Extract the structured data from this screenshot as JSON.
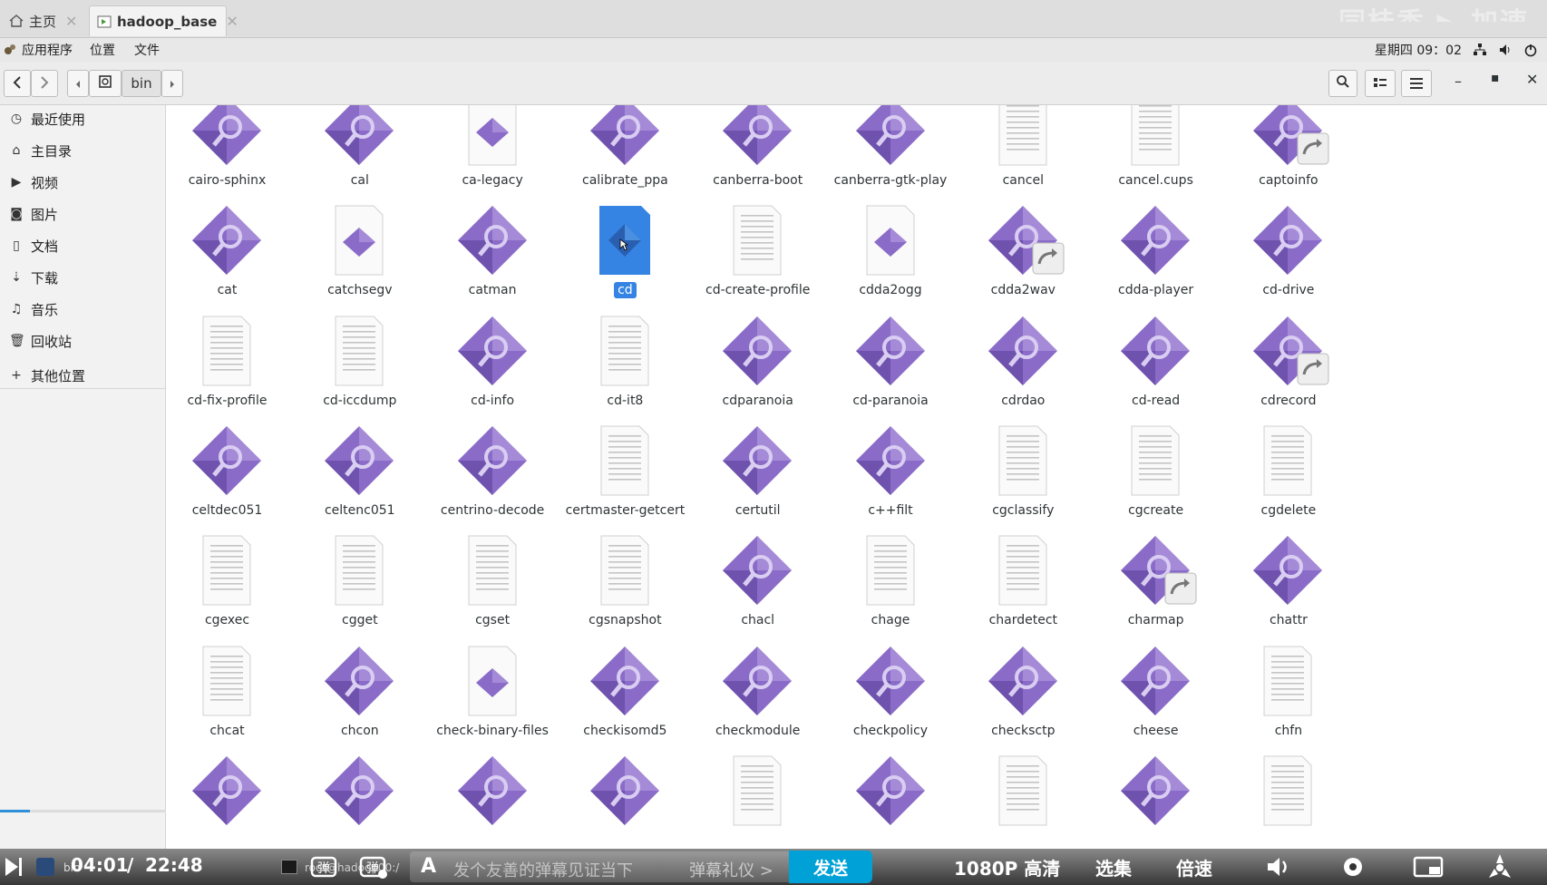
{
  "tabs": [
    {
      "label": "主页"
    },
    {
      "label": "hadoop_base"
    }
  ],
  "watermark": "同桂香 ▶ 加速",
  "menubar": {
    "items": [
      "应用程序",
      "位置",
      "文件"
    ],
    "clock": "星期四 09：02"
  },
  "toolbar": {
    "path_segment": "bin"
  },
  "sidebar": {
    "items": [
      {
        "label": "最近使用",
        "icon": "clock-icon"
      },
      {
        "label": "主目录",
        "icon": "home-icon"
      },
      {
        "label": "视频",
        "icon": "video-icon"
      },
      {
        "label": "图片",
        "icon": "camera-icon"
      },
      {
        "label": "文档",
        "icon": "document-icon"
      },
      {
        "label": "下载",
        "icon": "download-icon"
      },
      {
        "label": "音乐",
        "icon": "music-icon"
      },
      {
        "label": "回收站",
        "icon": "trash-icon"
      }
    ],
    "other": {
      "label": "其他位置",
      "icon": "plus-icon"
    },
    "playback_progress": 0.178
  },
  "files": [
    [
      {
        "name": "cairo-sphinx",
        "type": "exec"
      },
      {
        "name": "cal",
        "type": "exec"
      },
      {
        "name": "ca-legacy",
        "type": "script"
      },
      {
        "name": "calibrate_ppa",
        "type": "exec"
      },
      {
        "name": "canberra-boot",
        "type": "exec"
      },
      {
        "name": "canberra-gtk-play",
        "type": "exec"
      },
      {
        "name": "cancel",
        "type": "text"
      },
      {
        "name": "cancel.cups",
        "type": "text"
      },
      {
        "name": "captoinfo",
        "type": "link"
      }
    ],
    [
      {
        "name": "cat",
        "type": "exec"
      },
      {
        "name": "catchsegv",
        "type": "script"
      },
      {
        "name": "catman",
        "type": "exec"
      },
      {
        "name": "cd",
        "type": "selected"
      },
      {
        "name": "cd-create-profile",
        "type": "text"
      },
      {
        "name": "cdda2ogg",
        "type": "script"
      },
      {
        "name": "cdda2wav",
        "type": "link"
      },
      {
        "name": "cdda-player",
        "type": "exec"
      },
      {
        "name": "cd-drive",
        "type": "exec"
      }
    ],
    [
      {
        "name": "cd-fix-profile",
        "type": "text"
      },
      {
        "name": "cd-iccdump",
        "type": "text"
      },
      {
        "name": "cd-info",
        "type": "exec"
      },
      {
        "name": "cd-it8",
        "type": "text"
      },
      {
        "name": "cdparanoia",
        "type": "exec"
      },
      {
        "name": "cd-paranoia",
        "type": "exec"
      },
      {
        "name": "cdrdao",
        "type": "exec"
      },
      {
        "name": "cd-read",
        "type": "exec"
      },
      {
        "name": "cdrecord",
        "type": "link"
      }
    ],
    [
      {
        "name": "celtdec051",
        "type": "exec"
      },
      {
        "name": "celtenc051",
        "type": "exec"
      },
      {
        "name": "centrino-decode",
        "type": "exec"
      },
      {
        "name": "certmaster-getcert",
        "type": "text"
      },
      {
        "name": "certutil",
        "type": "exec"
      },
      {
        "name": "c++filt",
        "type": "exec"
      },
      {
        "name": "cgclassify",
        "type": "text"
      },
      {
        "name": "cgcreate",
        "type": "text"
      },
      {
        "name": "cgdelete",
        "type": "text"
      }
    ],
    [
      {
        "name": "cgexec",
        "type": "text"
      },
      {
        "name": "cgget",
        "type": "text"
      },
      {
        "name": "cgset",
        "type": "text"
      },
      {
        "name": "cgsnapshot",
        "type": "text"
      },
      {
        "name": "chacl",
        "type": "exec"
      },
      {
        "name": "chage",
        "type": "text"
      },
      {
        "name": "chardetect",
        "type": "text"
      },
      {
        "name": "charmap",
        "type": "link"
      },
      {
        "name": "chattr",
        "type": "exec"
      }
    ],
    [
      {
        "name": "chcat",
        "type": "text"
      },
      {
        "name": "chcon",
        "type": "exec"
      },
      {
        "name": "check-binary-files",
        "type": "script"
      },
      {
        "name": "checkisomd5",
        "type": "exec"
      },
      {
        "name": "checkmodule",
        "type": "exec"
      },
      {
        "name": "checkpolicy",
        "type": "exec"
      },
      {
        "name": "checksctp",
        "type": "exec"
      },
      {
        "name": "cheese",
        "type": "exec"
      },
      {
        "name": "chfn",
        "type": "text"
      }
    ],
    [
      {
        "name": "",
        "type": "exec"
      },
      {
        "name": "",
        "type": "exec"
      },
      {
        "name": "",
        "type": "exec"
      },
      {
        "name": "",
        "type": "exec"
      },
      {
        "name": "",
        "type": "text"
      },
      {
        "name": "",
        "type": "exec"
      },
      {
        "name": "",
        "type": "text"
      },
      {
        "name": "",
        "type": "exec"
      },
      {
        "name": "",
        "type": "text"
      }
    ]
  ],
  "player": {
    "time_current": "04:01",
    "time_separator": "/",
    "time_total": "22:48",
    "taskbar_item1": "bin",
    "taskbar_item2": "root@hadoop00:/",
    "danmu_placeholder": "发个友善的弹幕见证当下",
    "danmu_etiquette": "弹幕礼仪 >",
    "send_label": "发送",
    "quality_label": "1080P 高清",
    "episodes_label": "选集",
    "speed_label": "倍速",
    "colors": {
      "accent": "#00a1d6",
      "selection": "#3584e4",
      "exec_icon": "#8a6cc8"
    }
  }
}
